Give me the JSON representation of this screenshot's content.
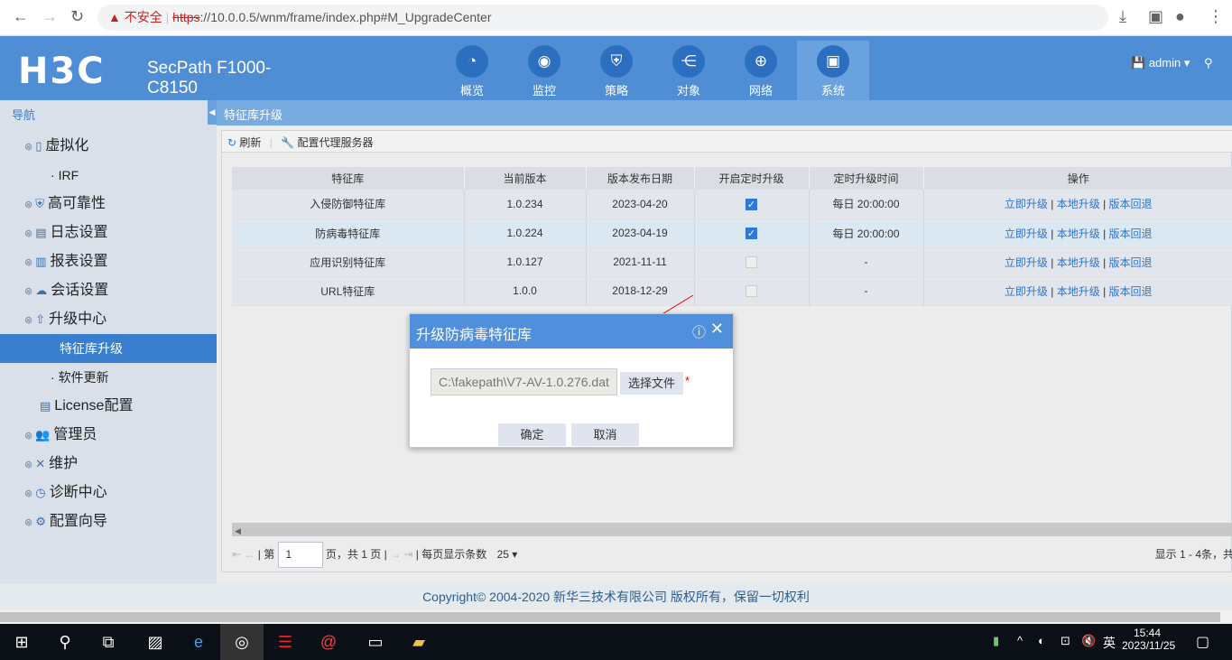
{
  "browser": {
    "insecure": "不安全",
    "url_scheme": "https",
    "url_rest": "://10.0.0.5/wnm/frame/index.php#M_UpgradeCenter"
  },
  "header": {
    "logo": "H3C",
    "product_line1": "SecPath F1000-",
    "product_line2": "C8150",
    "tabs": [
      {
        "label": "概览",
        "icon": "dashboard-icon"
      },
      {
        "label": "监控",
        "icon": "camera-icon"
      },
      {
        "label": "策略",
        "icon": "shield-icon"
      },
      {
        "label": "对象",
        "icon": "share-icon"
      },
      {
        "label": "网络",
        "icon": "globe-icon"
      },
      {
        "label": "系统",
        "icon": "monitor-icon"
      }
    ],
    "user": "admin"
  },
  "sidebar": {
    "title": "导航",
    "items": [
      "虚拟化",
      "IRF",
      "高可靠性",
      "日志设置",
      "报表设置",
      "会话设置",
      "升级中心",
      "特征库升级",
      "软件更新",
      "License配置",
      "管理员",
      "维护",
      "诊断中心",
      "配置向导"
    ]
  },
  "page": {
    "title": "特征库升级",
    "toolbar": {
      "refresh": "刷新",
      "proxy": "配置代理服务器"
    }
  },
  "table": {
    "headers": [
      "特征库",
      "当前版本",
      "版本发布日期",
      "开启定时升级",
      "定时升级时间",
      "操作"
    ],
    "rows": [
      {
        "name": "入侵防御特征库",
        "version": "1.0.234",
        "date": "2023-04-20",
        "scheduled": true,
        "time": "每日 20:00:00"
      },
      {
        "name": "防病毒特征库",
        "version": "1.0.224",
        "date": "2023-04-19",
        "scheduled": true,
        "time": "每日 20:00:00"
      },
      {
        "name": "应用识别特征库",
        "version": "1.0.127",
        "date": "2021-11-11",
        "scheduled": false,
        "time": "-"
      },
      {
        "name": "URL特征库",
        "version": "1.0.0",
        "date": "2018-12-29",
        "scheduled": false,
        "time": "-"
      }
    ],
    "actions": [
      "立即升级",
      "本地升级",
      "版本回退"
    ]
  },
  "pager": {
    "prefix": "第",
    "page": "1",
    "suffix": "页，共 1 页",
    "per_page_label": "每页显示条数",
    "per_page": "25",
    "summary": "显示 1 - 4条，共"
  },
  "dialog": {
    "title": "升级防病毒特征库",
    "file": "C:\\fakepath\\V7-AV-1.0.276.dat",
    "choose": "选择文件",
    "required": "*",
    "ok": "确定",
    "cancel": "取消"
  },
  "footer": "Copyright© 2004-2020 新华三技术有限公司 版权所有，保留一切权利",
  "taskbar": {
    "ime": "英",
    "time": "15:44",
    "date": "2023/11/25"
  }
}
